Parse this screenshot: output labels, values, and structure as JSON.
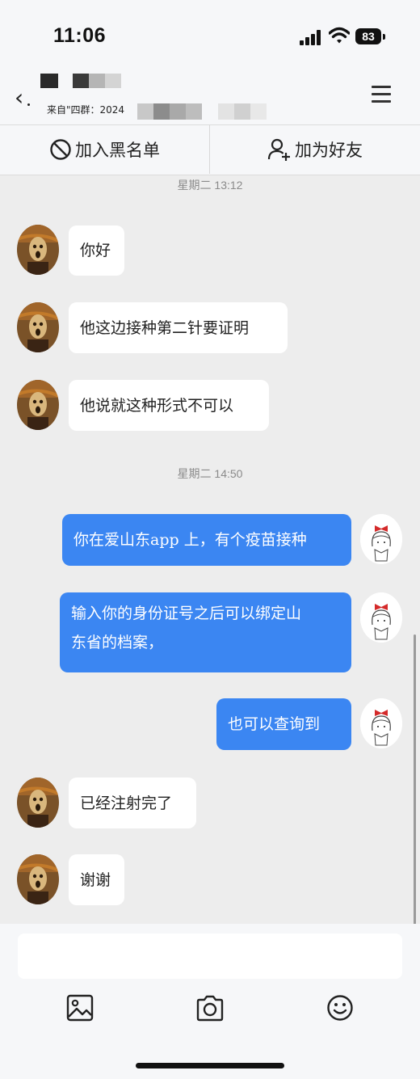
{
  "status_bar": {
    "time": "11:06",
    "battery": "83"
  },
  "header": {
    "subtitle": "来自\"四群：2024"
  },
  "actions": {
    "blacklist": "加入黑名单",
    "add_friend": "加为好友"
  },
  "messages": [
    {
      "type": "timestamp",
      "text": "星期二 13:12"
    },
    {
      "type": "in",
      "text": "你好"
    },
    {
      "type": "in",
      "text": "他这边接种第二针要证明"
    },
    {
      "type": "in",
      "text": "他说就这种形式不可以"
    },
    {
      "type": "timestamp",
      "text": "星期二 14:50"
    },
    {
      "type": "out",
      "text": "你在爱山东app 上，有个疫苗接种"
    },
    {
      "type": "out",
      "lines": [
        "输入你的身份证号之后可以绑定山",
        "东省的档案，"
      ]
    },
    {
      "type": "out",
      "text": "也可以查询到"
    },
    {
      "type": "in",
      "text": "已经注射完了"
    },
    {
      "type": "in",
      "text": "谢谢"
    }
  ],
  "toolbar": {
    "icons": [
      "image-icon",
      "camera-icon",
      "emoji-icon"
    ]
  },
  "colors": {
    "outgoing_bubble": "#3b86f2",
    "incoming_bubble": "#ffffff",
    "background": "#ededed"
  }
}
